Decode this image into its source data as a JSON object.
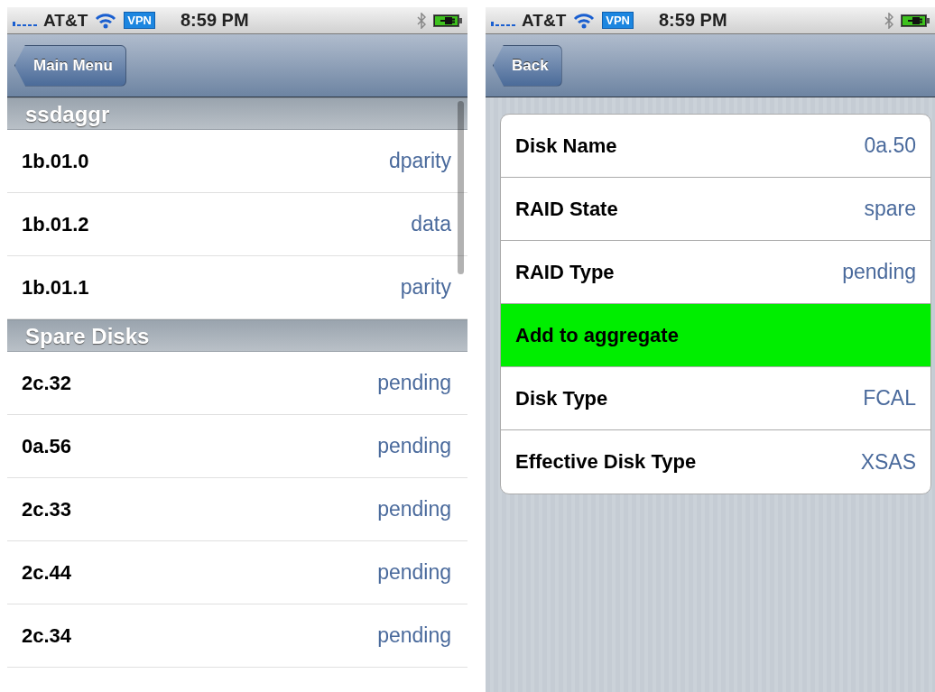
{
  "left_screen": {
    "status_bar": {
      "carrier": "AT&T",
      "vpn": "VPN",
      "time": "8:59 PM"
    },
    "nav_bar": {
      "back_button": "Main Menu"
    },
    "sections": [
      {
        "header": "ssdaggr",
        "rows": [
          {
            "name": "1b.01.0",
            "value": "dparity"
          },
          {
            "name": "1b.01.2",
            "value": "data"
          },
          {
            "name": "1b.01.1",
            "value": "parity"
          }
        ]
      },
      {
        "header": "Spare Disks",
        "rows": [
          {
            "name": "2c.32",
            "value": "pending"
          },
          {
            "name": "0a.56",
            "value": "pending"
          },
          {
            "name": "2c.33",
            "value": "pending"
          },
          {
            "name": "2c.44",
            "value": "pending"
          },
          {
            "name": "2c.34",
            "value": "pending"
          }
        ]
      }
    ]
  },
  "right_screen": {
    "status_bar": {
      "carrier": "AT&T",
      "vpn": "VPN",
      "time": "8:59 PM"
    },
    "nav_bar": {
      "back_button": "Back"
    },
    "rows": [
      {
        "kind": "detail",
        "label": "Disk Name",
        "value": "0a.50"
      },
      {
        "kind": "detail",
        "label": "RAID State",
        "value": "spare"
      },
      {
        "kind": "detail",
        "label": "RAID Type",
        "value": "pending"
      },
      {
        "kind": "action",
        "label": "Add to aggregate"
      },
      {
        "kind": "detail",
        "label": "Disk Type",
        "value": "FCAL"
      },
      {
        "kind": "detail",
        "label": "Effective Disk Type",
        "value": "XSAS"
      }
    ]
  }
}
